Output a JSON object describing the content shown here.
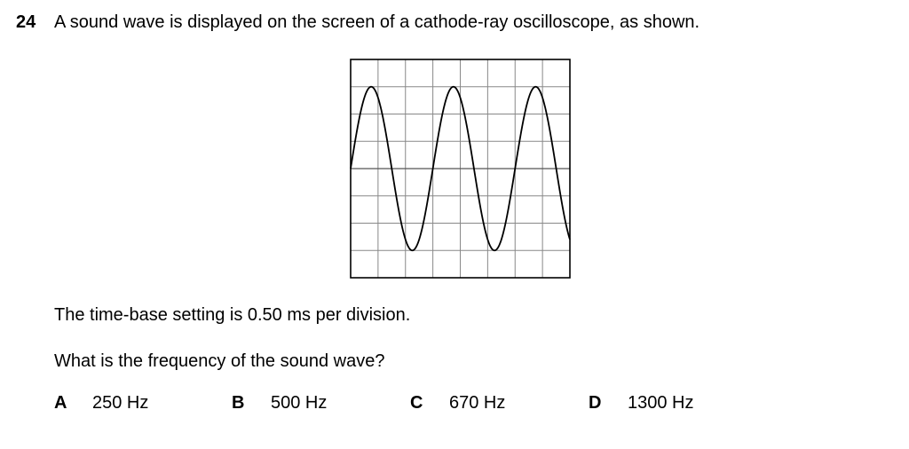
{
  "question": {
    "number": "24",
    "stem": "A sound wave is displayed on the screen of a cathode-ray oscilloscope, as shown.",
    "timebase_text": "The time-base setting is 0.50 ms per division.",
    "prompt": "What is the frequency of the sound wave?"
  },
  "options": [
    {
      "letter": "A",
      "value": "250 Hz"
    },
    {
      "letter": "B",
      "value": "500 Hz"
    },
    {
      "letter": "C",
      "value": "670 Hz"
    },
    {
      "letter": "D",
      "value": "1300 Hz"
    }
  ],
  "oscilloscope": {
    "grid_columns": 8,
    "grid_rows": 8,
    "divisions_per_cycle": 3,
    "cycles_shown": 2.667,
    "amplitude_divisions": 3,
    "start_phase": "zero-crossing-rising",
    "colors": {
      "grid": "#888888",
      "frame": "#000000",
      "trace": "#000000"
    }
  }
}
